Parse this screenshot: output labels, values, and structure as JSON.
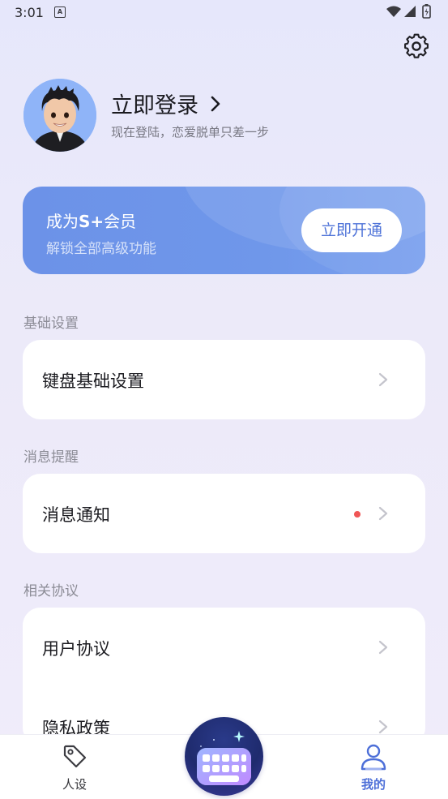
{
  "status_bar": {
    "time": "3:01",
    "a_badge": "A"
  },
  "header": {
    "settings_icon": "gear-icon"
  },
  "profile": {
    "title": "立即登录",
    "subtitle": "现在登陆，恋爱脱单只差一步"
  },
  "vip_card": {
    "title_prefix": "成为",
    "title_brand": "S+",
    "title_suffix": "会员",
    "subtitle": "解锁全部高级功能",
    "button_label": "立即开通",
    "colors": {
      "card": "#6f97ea",
      "button_text": "#4d72d8"
    }
  },
  "sections": {
    "basic": {
      "label": "基础设置",
      "items": [
        {
          "label": "键盘基础设置"
        }
      ]
    },
    "notify": {
      "label": "消息提醒",
      "items": [
        {
          "label": "消息通知",
          "unread_dot": true
        }
      ]
    },
    "agreements": {
      "label": "相关协议",
      "items": [
        {
          "label": "用户协议"
        },
        {
          "label": "隐私政策"
        }
      ]
    }
  },
  "bottom_nav": {
    "items": [
      {
        "label": "人设",
        "icon": "tag-icon"
      },
      {
        "label": "我的",
        "icon": "person-icon",
        "active": true
      }
    ],
    "center_icon": "keyboard-icon",
    "colors": {
      "active": "#4d6fd8"
    }
  }
}
